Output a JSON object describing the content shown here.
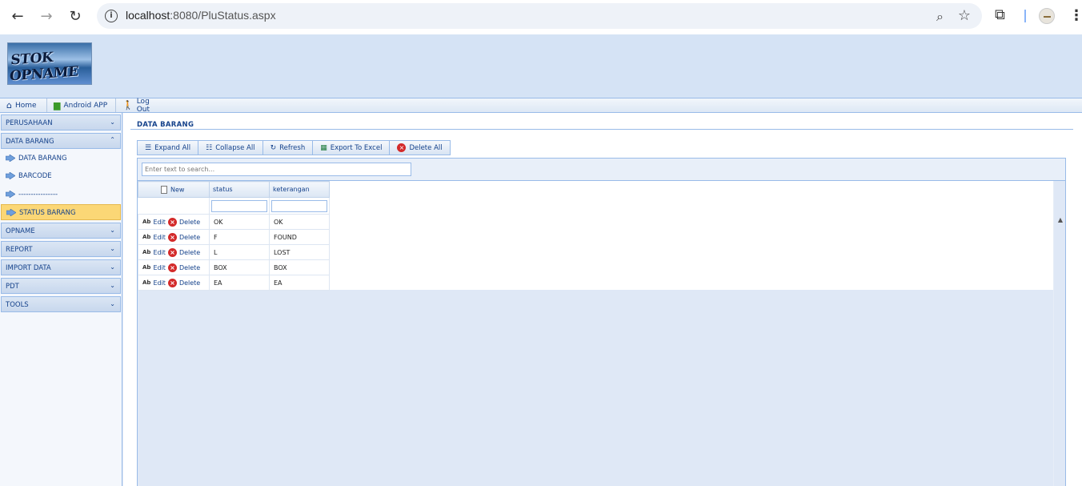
{
  "browser": {
    "url_host": "localhost",
    "url_path": ":8080/PluStatus.aspx"
  },
  "logo_text": "STOK OPNAME",
  "topmenu": [
    {
      "label": "Home",
      "icon": "home-icon"
    },
    {
      "label": "Android APP",
      "icon": "android-icon"
    },
    {
      "label": "Log Out",
      "icon": "person-walking-icon"
    }
  ],
  "leftnav": {
    "groups": {
      "perusahaan": "PERUSAHAAN",
      "data_barang": "DATA BARANG",
      "opname": "OPNAME",
      "report": "REPORT",
      "import_data": "IMPORT DATA",
      "pdt": "PDT",
      "tools": "TOOLS"
    },
    "items": [
      "DATA BARANG",
      "BARCODE",
      "----------------",
      "STATUS BARANG"
    ]
  },
  "main": {
    "title": "DATA BARANG",
    "toolbar": {
      "expand_all": "Expand All",
      "collapse_all": "Collapse All",
      "refresh": "Refresh",
      "export_excel": "Export To Excel",
      "delete_all": "Delete All"
    },
    "search_placeholder": "Enter text to search...",
    "grid": {
      "new_label": "New",
      "columns": [
        "status",
        "keterangan"
      ],
      "edit_label": "Edit",
      "delete_label": "Delete",
      "rows": [
        {
          "status": "OK",
          "keterangan": "OK"
        },
        {
          "status": "F",
          "keterangan": "FOUND"
        },
        {
          "status": "L",
          "keterangan": "LOST"
        },
        {
          "status": "BOX",
          "keterangan": "BOX"
        },
        {
          "status": "EA",
          "keterangan": "EA"
        }
      ]
    }
  }
}
